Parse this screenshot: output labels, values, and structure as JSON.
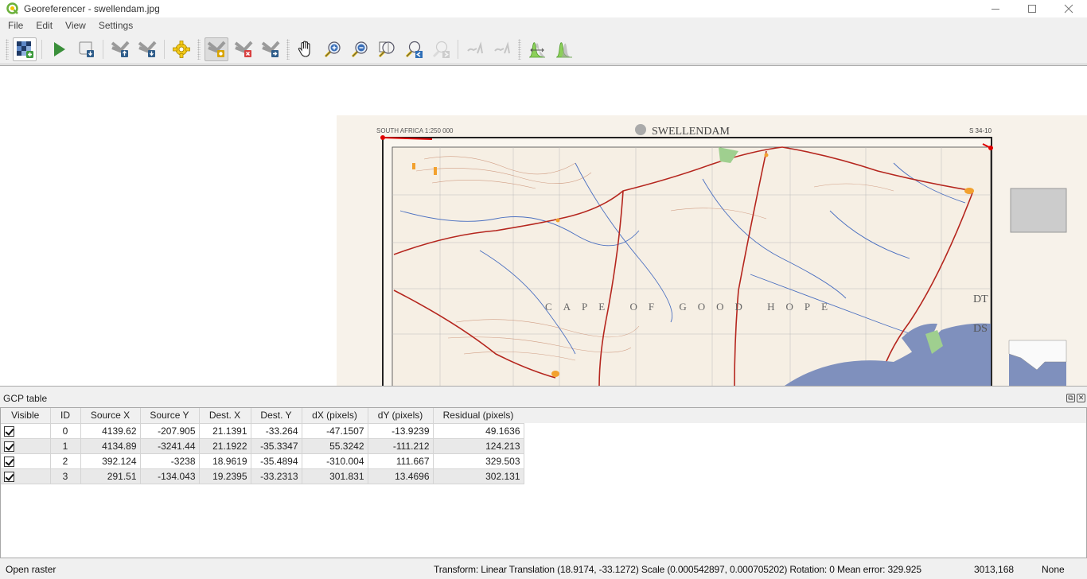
{
  "window": {
    "title": "Georeferencer - swellendam.jpg",
    "app_icon": "qgis-logo-icon",
    "controls": [
      "minimize-icon",
      "maximize-icon",
      "close-icon"
    ]
  },
  "menu": {
    "items": [
      {
        "label": "File"
      },
      {
        "label": "Edit"
      },
      {
        "label": "View"
      },
      {
        "label": "Settings"
      }
    ]
  },
  "toolbar": {
    "buttons": [
      {
        "name": "open-raster",
        "icon": "add-raster-icon"
      },
      {
        "name": "start-georeferencing",
        "icon": "play-icon"
      },
      {
        "name": "generate-gdal-script",
        "icon": "script-icon"
      },
      {
        "name": "load-gcp-points",
        "icon": "load-gcp-icon"
      },
      {
        "name": "save-gcp-points",
        "icon": "save-gcp-icon"
      },
      {
        "name": "transformation-settings",
        "icon": "gear-icon"
      },
      {
        "name": "add-point",
        "icon": "add-point-icon",
        "active": true
      },
      {
        "name": "delete-point",
        "icon": "delete-point-icon"
      },
      {
        "name": "move-gcp-point",
        "icon": "move-point-icon"
      },
      {
        "name": "pan",
        "icon": "pan-hand-icon"
      },
      {
        "name": "zoom-in",
        "icon": "zoom-in-icon"
      },
      {
        "name": "zoom-out",
        "icon": "zoom-out-icon"
      },
      {
        "name": "zoom-to-layer",
        "icon": "zoom-full-icon"
      },
      {
        "name": "zoom-last",
        "icon": "zoom-last-icon"
      },
      {
        "name": "zoom-next",
        "icon": "zoom-next-icon",
        "disabled": true
      },
      {
        "name": "link-georeferencer-to-qgis",
        "icon": "link-geo-icon",
        "disabled": true
      },
      {
        "name": "link-qgis-to-georeferencer",
        "icon": "link-qgis-icon",
        "disabled": true
      },
      {
        "name": "local-histogram-stretch",
        "icon": "histogram-stretch-icon"
      },
      {
        "name": "full-histogram-stretch",
        "icon": "histogram-full-icon"
      }
    ]
  },
  "canvas": {
    "raster_name": "swellendam.jpg",
    "map_title": "SWELLENDAM",
    "map_subtitle": "SOUTH AFRICA 1:250 000",
    "sheet_number": "S 34-10",
    "map_label_region": "CAPE OF GOOD HOPE",
    "colors": {
      "paper": "#f7f2ea",
      "sea": "#7f90bd",
      "roads": "#b5261e",
      "rivers": "#4a6fc0",
      "contours": "#c88b6e",
      "towns": "#f2a12e",
      "gcp_marker": "#e00000"
    }
  },
  "gcp_table": {
    "title": "GCP table",
    "columns": [
      "Visible",
      "ID",
      "Source X",
      "Source Y",
      "Dest. X",
      "Dest. Y",
      "dX (pixels)",
      "dY (pixels)",
      "Residual (pixels)"
    ],
    "rows": [
      {
        "visible": true,
        "id": "0",
        "source_x": "4139.62",
        "source_y": "-207.905",
        "dest_x": "21.1391",
        "dest_y": "-33.264",
        "dx": "-47.1507",
        "dy": "-13.9239",
        "residual": "49.1636"
      },
      {
        "visible": true,
        "id": "1",
        "source_x": "4134.89",
        "source_y": "-3241.44",
        "dest_x": "21.1922",
        "dest_y": "-35.3347",
        "dx": "55.3242",
        "dy": "-111.212",
        "residual": "124.213"
      },
      {
        "visible": true,
        "id": "2",
        "source_x": "392.124",
        "source_y": "-3238",
        "dest_x": "18.9619",
        "dest_y": "-35.4894",
        "dx": "-310.004",
        "dy": "111.667",
        "residual": "329.503"
      },
      {
        "visible": true,
        "id": "3",
        "source_x": "291.51",
        "source_y": "-134.043",
        "dest_x": "19.2395",
        "dest_y": "-33.2313",
        "dx": "301.831",
        "dy": "13.4696",
        "residual": "302.131"
      }
    ],
    "dock_buttons": [
      "float-icon",
      "close-icon"
    ]
  },
  "statusbar": {
    "message": "Open raster",
    "transform": "Transform: Linear Translation (18.9174, -33.1272) Scale (0.000542897, 0.000705202) Rotation: 0 Mean error: 329.925",
    "coordinates": "3013,168",
    "crs": "None"
  }
}
